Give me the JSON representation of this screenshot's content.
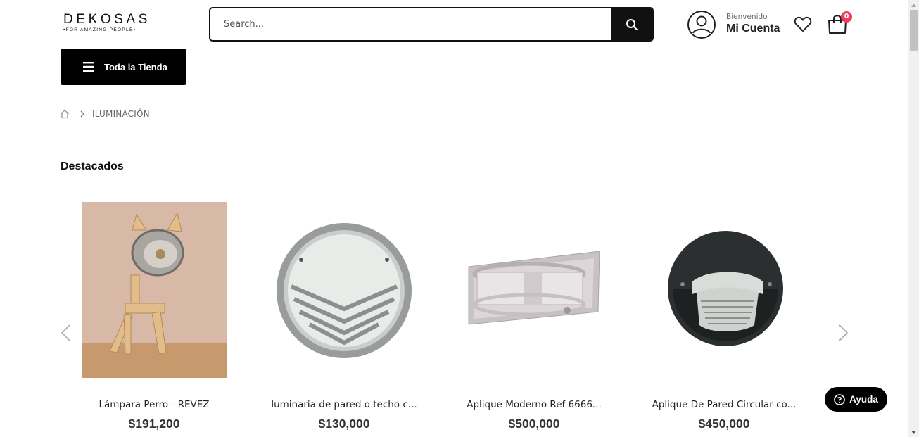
{
  "logo": {
    "name": "DEKOSAS",
    "tagline": "•FOR AMAZING PEOPLE•"
  },
  "search": {
    "placeholder": "Search..."
  },
  "account": {
    "welcome": "Bienvenido",
    "title": "Mi Cuenta"
  },
  "cart": {
    "count": "0"
  },
  "store_button": {
    "label": "Toda la Tienda"
  },
  "breadcrumb": {
    "current": "ILUMINACIÓN"
  },
  "section": {
    "title": "Destacados"
  },
  "products": [
    {
      "name": "Lámpara Perro - REVEZ",
      "price": "$191,200"
    },
    {
      "name": "luminaria de pared o techo c...",
      "price": "$130,000"
    },
    {
      "name": "Aplique Moderno Ref 6666...",
      "price": "$500,000"
    },
    {
      "name": "Aplique De Pared Circular co...",
      "price": "$450,000"
    }
  ],
  "help": {
    "label": "Ayuda"
  },
  "colors": {
    "badge": "#ee3d5c",
    "primary": "#000000"
  }
}
